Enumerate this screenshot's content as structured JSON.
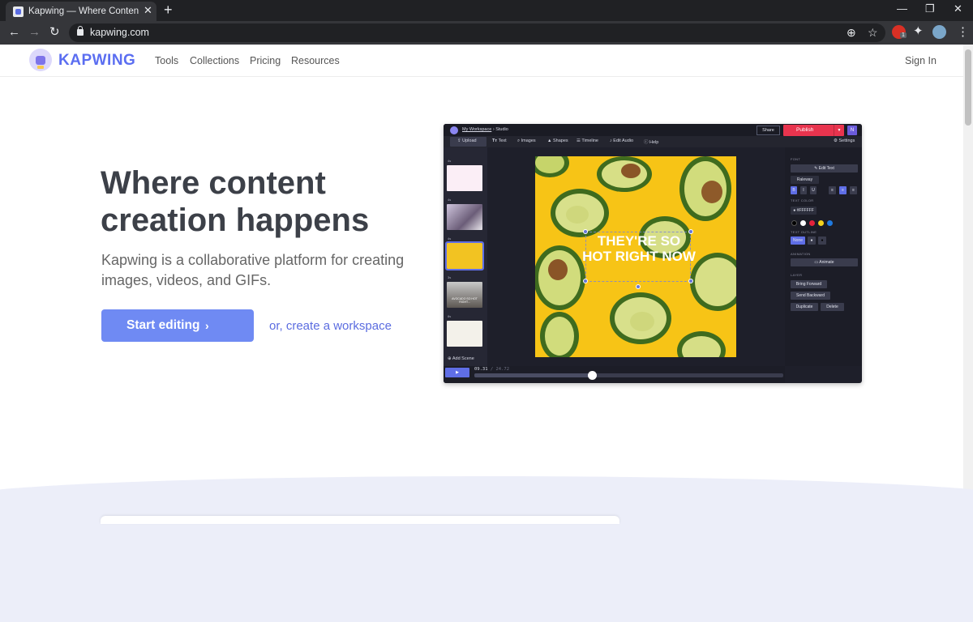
{
  "browser": {
    "tab_title": "Kapwing — Where Content Creat",
    "url": "kapwing.com",
    "extension_badge": "1"
  },
  "site": {
    "logo_text": "KAPWING",
    "nav": [
      "Tools",
      "Collections",
      "Pricing",
      "Resources"
    ],
    "signin": "Sign In"
  },
  "hero": {
    "title": "Where content creation happens",
    "subtitle": "Kapwing is a collaborative platform for creating images, videos, and GIFs.",
    "cta_label": "Start editing",
    "cta_chevron": "›",
    "workspace_link": "or, create a workspace"
  },
  "editor": {
    "breadcrumb_workspace": "My Workspace",
    "breadcrumb_sep": "›",
    "breadcrumb_page": "Studio",
    "share": "Share",
    "publish": "Publish",
    "user_initial": "N",
    "tools": [
      "Upload",
      "Text",
      "Images",
      "Shapes",
      "Timeline",
      "Edit Audio",
      "Help"
    ],
    "settings": "Settings",
    "scene_durations": [
      "4s",
      "4s",
      "4s",
      "3s",
      "8s"
    ],
    "thumb_caption": "AVOCADO SO HOT RIGHT...",
    "add_scene": "Add Scene",
    "canvas_text": "THEY'RE SO HOT RIGHT NOW",
    "panel": {
      "font_label": "FONT",
      "edit_text": "Edit Text",
      "font_name": "Raleway",
      "bold": "B",
      "italic": "I",
      "underline": "U",
      "text_color_label": "TEXT COLOR",
      "color_hex": "#FFFFFF",
      "outline_label": "TEXT OUTLINE",
      "outline_none": "None",
      "animation_label": "ANIMATION",
      "animate": "Animate",
      "layer_label": "LAYER",
      "bring_forward": "Bring Forward",
      "send_backward": "Send Backward",
      "duplicate": "Duplicate",
      "delete": "Delete"
    },
    "swatches": [
      "#000000",
      "#ffffff",
      "#e5223b",
      "#f4d21c",
      "#1f7ae0"
    ],
    "time_current": "09.31",
    "time_total": "24.72",
    "playhead_fraction": 0.38
  },
  "colors": {
    "brand": "#5b6ef1",
    "cta": "#6f8af3",
    "publish": "#e8344e",
    "canvas_bg": "#f7c416"
  }
}
